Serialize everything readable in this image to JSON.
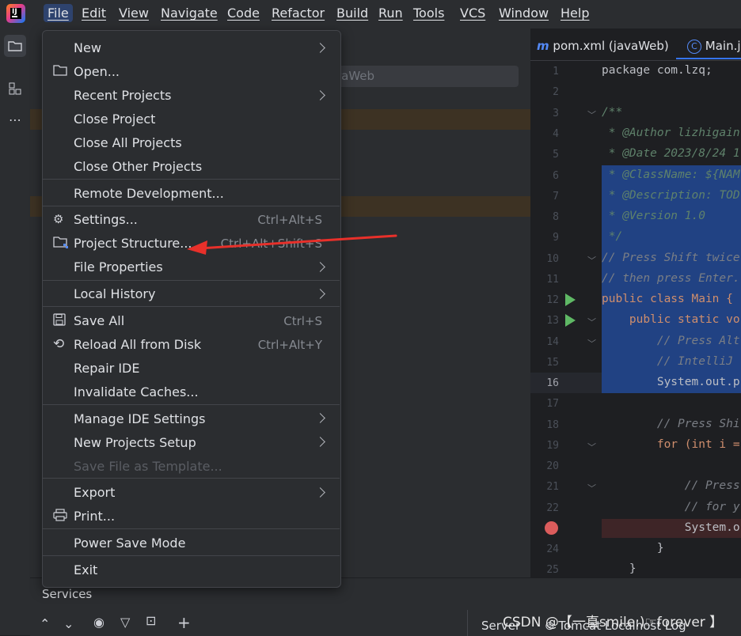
{
  "menubar": {
    "items": [
      "File",
      "Edit",
      "View",
      "Navigate",
      "Code",
      "Refactor",
      "Build",
      "Run",
      "Tools",
      "VCS",
      "Window",
      "Help"
    ]
  },
  "project": {
    "search_text": "raWeb"
  },
  "editor": {
    "tabs": [
      "pom.xml (javaWeb)",
      "Main.j"
    ],
    "line_numbers": [
      "1",
      "2",
      "3",
      "4",
      "5",
      "6",
      "7",
      "8",
      "9",
      "10",
      "11",
      "12",
      "13",
      "14",
      "15",
      "16",
      "17",
      "18",
      "19",
      "20",
      "21",
      "22",
      "24",
      "25"
    ],
    "code": [
      "package com.lzq;",
      "",
      "/**",
      " * @Author lizhigain",
      " * @Date 2023/8/24 1",
      " * @ClassName: ${NAM",
      " * @Description: TOD",
      " * @Version 1.0",
      " */",
      "// Press Shift twice",
      "// then press Enter.",
      "public class Main {",
      "    public static vo",
      "        // Press Alt",
      "        // IntelliJ",
      "        System.out.p",
      "",
      "        // Press Shi",
      "        for (int i =",
      "",
      "            // Press",
      "            // for y",
      "            System.o",
      "        }",
      "    }"
    ]
  },
  "file_menu": {
    "items": [
      {
        "label": "New"
      },
      {
        "label": "Open..."
      },
      {
        "label": "Recent Projects"
      },
      {
        "label": "Close Project"
      },
      {
        "label": "Close All Projects"
      },
      {
        "label": "Close Other Projects"
      },
      {
        "label": "Remote Development..."
      },
      {
        "label": "Settings...",
        "shortcut": "Ctrl+Alt+S"
      },
      {
        "label": "Project Structure...",
        "shortcut": "Ctrl+Alt+Shift+S"
      },
      {
        "label": "File Properties"
      },
      {
        "label": "Local History"
      },
      {
        "label": "Save All",
        "shortcut": "Ctrl+S"
      },
      {
        "label": "Reload All from Disk",
        "shortcut": "Ctrl+Alt+Y"
      },
      {
        "label": "Repair IDE"
      },
      {
        "label": "Invalidate Caches..."
      },
      {
        "label": "Manage IDE Settings"
      },
      {
        "label": "New Projects Setup"
      },
      {
        "label": "Save File as Template..."
      },
      {
        "label": "Export"
      },
      {
        "label": "Print..."
      },
      {
        "label": "Power Save Mode"
      },
      {
        "label": "Exit"
      }
    ]
  },
  "services": {
    "title": "Services",
    "server_tab": "Server",
    "tomcat_tab": "Tomcat Localhost Log"
  },
  "watermark": "CSDN @【一直smile:)☞forever 】",
  "colors": {
    "accent": "#2e436e",
    "selection": "#214283",
    "annotation_arrow": "#e8302a"
  }
}
